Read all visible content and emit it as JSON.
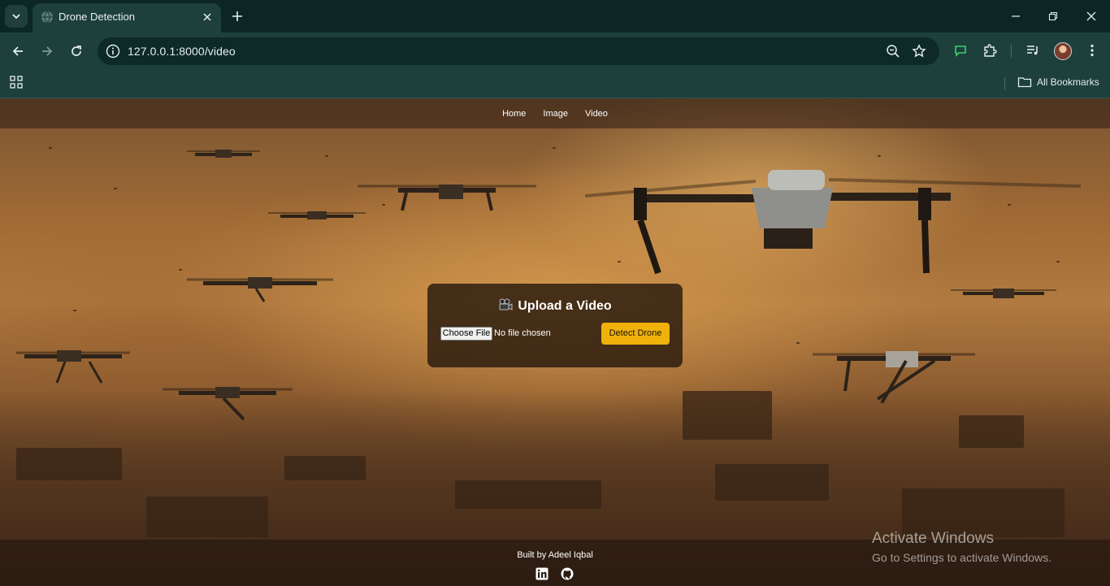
{
  "browser": {
    "tab": {
      "title": "Drone Detection"
    },
    "address_bar": {
      "url": "127.0.0.1:8000/video"
    },
    "bookmarks_bar": {
      "all_bookmarks_label": "All Bookmarks"
    }
  },
  "page": {
    "nav": {
      "items": [
        "Home",
        "Image",
        "Video"
      ]
    },
    "upload_card": {
      "title": "Upload a Video",
      "choose_file_label": "Choose File",
      "file_status": "No file chosen",
      "submit_label": "Detect Drone"
    },
    "footer": {
      "credit": "Built by Adeel Iqbal",
      "social_icons": [
        "linkedin-icon",
        "github-icon"
      ]
    }
  },
  "overlay": {
    "activate_title": "Activate Windows",
    "activate_subtitle": "Go to Settings to activate Windows."
  },
  "colors": {
    "chrome_dark": "#0c2624",
    "chrome_toolbar": "#1d403d",
    "accent_button": "#f0b20a",
    "card_bg": "#281a0e"
  }
}
